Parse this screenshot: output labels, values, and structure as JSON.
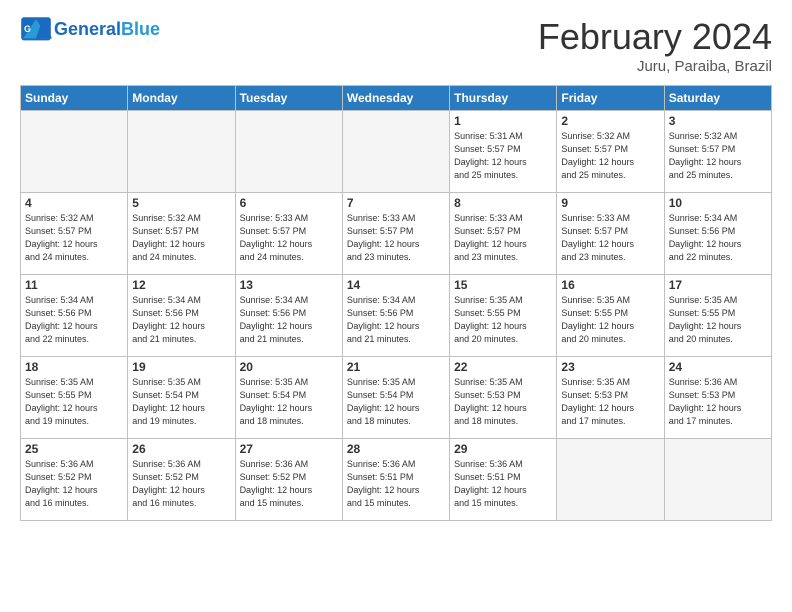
{
  "header": {
    "logo_general": "General",
    "logo_blue": "Blue",
    "month_title": "February 2024",
    "location": "Juru, Paraiba, Brazil"
  },
  "days_of_week": [
    "Sunday",
    "Monday",
    "Tuesday",
    "Wednesday",
    "Thursday",
    "Friday",
    "Saturday"
  ],
  "weeks": [
    [
      {
        "day": "",
        "info": "",
        "empty": true
      },
      {
        "day": "",
        "info": "",
        "empty": true
      },
      {
        "day": "",
        "info": "",
        "empty": true
      },
      {
        "day": "",
        "info": "",
        "empty": true
      },
      {
        "day": "1",
        "info": "Sunrise: 5:31 AM\nSunset: 5:57 PM\nDaylight: 12 hours\nand 25 minutes."
      },
      {
        "day": "2",
        "info": "Sunrise: 5:32 AM\nSunset: 5:57 PM\nDaylight: 12 hours\nand 25 minutes."
      },
      {
        "day": "3",
        "info": "Sunrise: 5:32 AM\nSunset: 5:57 PM\nDaylight: 12 hours\nand 25 minutes."
      }
    ],
    [
      {
        "day": "4",
        "info": "Sunrise: 5:32 AM\nSunset: 5:57 PM\nDaylight: 12 hours\nand 24 minutes."
      },
      {
        "day": "5",
        "info": "Sunrise: 5:32 AM\nSunset: 5:57 PM\nDaylight: 12 hours\nand 24 minutes."
      },
      {
        "day": "6",
        "info": "Sunrise: 5:33 AM\nSunset: 5:57 PM\nDaylight: 12 hours\nand 24 minutes."
      },
      {
        "day": "7",
        "info": "Sunrise: 5:33 AM\nSunset: 5:57 PM\nDaylight: 12 hours\nand 23 minutes."
      },
      {
        "day": "8",
        "info": "Sunrise: 5:33 AM\nSunset: 5:57 PM\nDaylight: 12 hours\nand 23 minutes."
      },
      {
        "day": "9",
        "info": "Sunrise: 5:33 AM\nSunset: 5:57 PM\nDaylight: 12 hours\nand 23 minutes."
      },
      {
        "day": "10",
        "info": "Sunrise: 5:34 AM\nSunset: 5:56 PM\nDaylight: 12 hours\nand 22 minutes."
      }
    ],
    [
      {
        "day": "11",
        "info": "Sunrise: 5:34 AM\nSunset: 5:56 PM\nDaylight: 12 hours\nand 22 minutes."
      },
      {
        "day": "12",
        "info": "Sunrise: 5:34 AM\nSunset: 5:56 PM\nDaylight: 12 hours\nand 21 minutes."
      },
      {
        "day": "13",
        "info": "Sunrise: 5:34 AM\nSunset: 5:56 PM\nDaylight: 12 hours\nand 21 minutes."
      },
      {
        "day": "14",
        "info": "Sunrise: 5:34 AM\nSunset: 5:56 PM\nDaylight: 12 hours\nand 21 minutes."
      },
      {
        "day": "15",
        "info": "Sunrise: 5:35 AM\nSunset: 5:55 PM\nDaylight: 12 hours\nand 20 minutes."
      },
      {
        "day": "16",
        "info": "Sunrise: 5:35 AM\nSunset: 5:55 PM\nDaylight: 12 hours\nand 20 minutes."
      },
      {
        "day": "17",
        "info": "Sunrise: 5:35 AM\nSunset: 5:55 PM\nDaylight: 12 hours\nand 20 minutes."
      }
    ],
    [
      {
        "day": "18",
        "info": "Sunrise: 5:35 AM\nSunset: 5:55 PM\nDaylight: 12 hours\nand 19 minutes."
      },
      {
        "day": "19",
        "info": "Sunrise: 5:35 AM\nSunset: 5:54 PM\nDaylight: 12 hours\nand 19 minutes."
      },
      {
        "day": "20",
        "info": "Sunrise: 5:35 AM\nSunset: 5:54 PM\nDaylight: 12 hours\nand 18 minutes."
      },
      {
        "day": "21",
        "info": "Sunrise: 5:35 AM\nSunset: 5:54 PM\nDaylight: 12 hours\nand 18 minutes."
      },
      {
        "day": "22",
        "info": "Sunrise: 5:35 AM\nSunset: 5:53 PM\nDaylight: 12 hours\nand 18 minutes."
      },
      {
        "day": "23",
        "info": "Sunrise: 5:35 AM\nSunset: 5:53 PM\nDaylight: 12 hours\nand 17 minutes."
      },
      {
        "day": "24",
        "info": "Sunrise: 5:36 AM\nSunset: 5:53 PM\nDaylight: 12 hours\nand 17 minutes."
      }
    ],
    [
      {
        "day": "25",
        "info": "Sunrise: 5:36 AM\nSunset: 5:52 PM\nDaylight: 12 hours\nand 16 minutes."
      },
      {
        "day": "26",
        "info": "Sunrise: 5:36 AM\nSunset: 5:52 PM\nDaylight: 12 hours\nand 16 minutes."
      },
      {
        "day": "27",
        "info": "Sunrise: 5:36 AM\nSunset: 5:52 PM\nDaylight: 12 hours\nand 15 minutes."
      },
      {
        "day": "28",
        "info": "Sunrise: 5:36 AM\nSunset: 5:51 PM\nDaylight: 12 hours\nand 15 minutes."
      },
      {
        "day": "29",
        "info": "Sunrise: 5:36 AM\nSunset: 5:51 PM\nDaylight: 12 hours\nand 15 minutes."
      },
      {
        "day": "",
        "info": "",
        "empty": true
      },
      {
        "day": "",
        "info": "",
        "empty": true
      }
    ]
  ]
}
